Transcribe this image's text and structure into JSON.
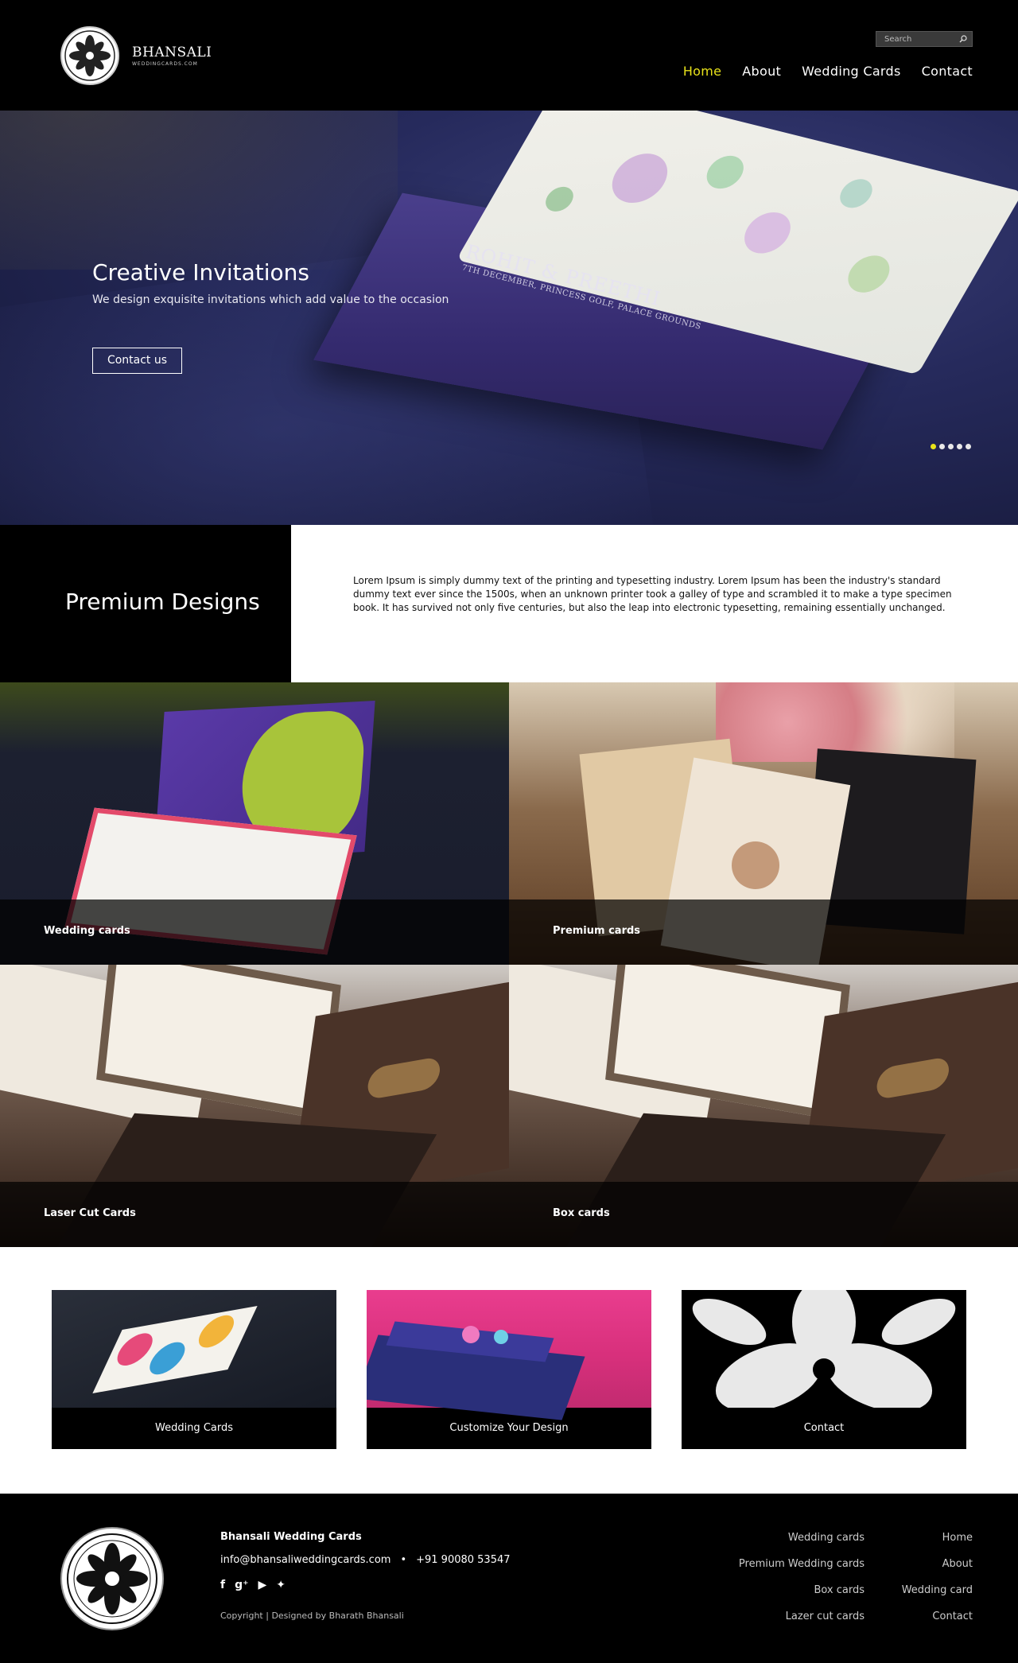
{
  "brand": {
    "name": "BHANSALI",
    "sub": "WEDDINGCARDS.COM"
  },
  "search": {
    "placeholder": "Search"
  },
  "nav": [
    {
      "label": "Home",
      "active": true
    },
    {
      "label": "About"
    },
    {
      "label": "Wedding Cards"
    },
    {
      "label": "Contact"
    }
  ],
  "hero": {
    "title": "Creative Invitations",
    "subtitle": "We design exquisite invitations which add value to the occasion",
    "button": "Contact us",
    "card_names": "ROHIT & PREETHI",
    "card_detail": "7TH DECEMBER, PRINCESS GOLF, PALACE GROUNDS",
    "slides_total": 5,
    "slide_active": 1
  },
  "premium": {
    "title": "Premium Designs",
    "text": "Lorem Ipsum is simply dummy text of the printing and typesetting industry. Lorem Ipsum has been the industry's standard dummy text ever since the 1500s, when an unknown printer took a galley of type and scrambled it to make a type specimen book. It has survived not only five centuries, but also the leap into electronic typesetting, remaining essentially unchanged."
  },
  "tiles": [
    {
      "label": "Wedding cards"
    },
    {
      "label": "Premium cards"
    },
    {
      "label": "Laser Cut Cards"
    },
    {
      "label": "Box cards"
    }
  ],
  "boxes": [
    {
      "label": "Wedding Cards"
    },
    {
      "label": "Customize Your Design"
    },
    {
      "label": "Contact"
    }
  ],
  "footer": {
    "name": "Bhansali Wedding Cards",
    "email": "info@bhansaliweddingcards.com",
    "bullet": "•",
    "phone": "+91 90080 53547",
    "social": [
      "facebook-icon",
      "google-plus-icon",
      "youtube-icon",
      "twitter-icon"
    ],
    "copyright": "Copyright  |  Designed by Bharath Bhansali",
    "col1": [
      "Wedding cards",
      "Premium Wedding cards",
      "Box cards",
      "Lazer cut cards"
    ],
    "col2": [
      "Home",
      "About",
      "Wedding card",
      "Contact"
    ]
  },
  "colors": {
    "accent": "#e8e21a",
    "background": "#000000"
  }
}
